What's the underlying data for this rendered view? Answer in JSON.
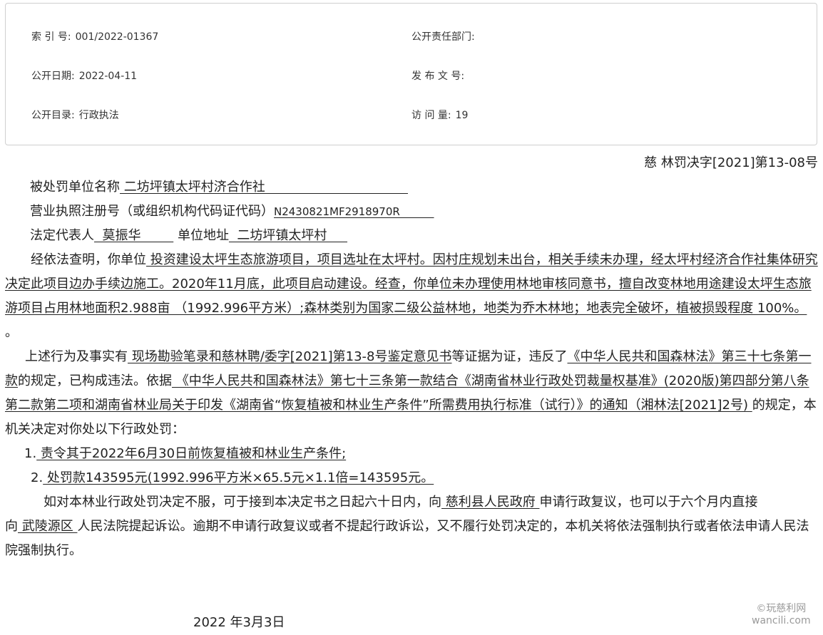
{
  "meta": {
    "index_label": "索 引 号:",
    "index_value": "001/2022-01367",
    "dept_label": "公开责任部门:",
    "dept_value": "",
    "date_label": "公开日期:",
    "date_value": "2022-04-11",
    "docno_label": "发 布 文 号:",
    "docno_value": "",
    "catalog_label": "公开目录:",
    "catalog_value": "行政执法",
    "visits_label": "访 问 量:",
    "visits_value": "19"
  },
  "doc": {
    "number": "慈 林罚决字[2021]第13-08号",
    "unit_label": "被处罚单位名称",
    "unit_value": " 二坊坪镇太坪村济合作社                                   ",
    "license_label": "营业执照注册号（或组织机构代码证代码）",
    "license_value": "N2430821MF2918970R          ",
    "rep_label": "法定代表人",
    "rep_value": "  莫振华        ",
    "addr_label": "单位地址",
    "addr_value": "  二坊坪镇太坪村     ",
    "p1_lead": "经依法查明，你单位",
    "p1_body": " 投资建设太坪生态旅游项目，项目选址在太坪村。因村庄规划未出台，相关手续未办理，经太坪村经济合作社集体研究决定此项目边办手续边施工。2020年11月底，此项目启动建设。经查，你单位未办理使用林地审核同意书，擅自改变林地用途建设太坪生态旅游项目占用林地面积2.988亩 （1992.996平方米）;森林类别为国家二级公益林地，地类为乔木林地；地表完全破坏，植被损毁程度 100%。 ",
    "p1_end": "。",
    "p2_a": "上述行为及事实有",
    "p2_b": " 现场勘验笔录和慈林聘/委字[2021]第13-8号鉴定意见书",
    "p2_c": "等证据为证，违反了",
    "p2_d": "《中华人民共和国森林法》第三十七条第一款",
    "p2_e": "的规定，已构成违法。依据",
    "p2_f": " 《中华人民共和国森林法》第七十三条第一款结合《湖南省林业行政处罚裁量权基准》(2020版)第四部分第八条第二款第二项和湖南省林业局关于印发《湖南省“恢复植被和林业生产条件”所需费用执行标准（试行）》的通知（湘林法[2021]2号) ",
    "p2_g": "的规定，本机关决定对你处以下行政处罚：",
    "item1_num": "1.",
    "item1_text": " 责令其于2022年6月30日前恢复植被和林业生产条件; ",
    "item2_num": "2.",
    "item2_text": " 处罚款143595元(1992.996平方米×65.5元×1.1倍=143595元。 ",
    "p3_a": "如对本林业行政处罚决定不服，可于接到本决定书之日起六十日内，向",
    "p3_b": " 慈利县人民政府 ",
    "p3_c": "申请行政复议，也可以于六个月内直接",
    "p4_a": "向",
    "p4_b": " 武陵源区 ",
    "p4_c": "人民法院提起诉讼。逾期不申请行政复议或者不提起行政诉讼，又不履行处罚决定的，本机关将依法强制执行或者依法申请人民法院强制执行。",
    "date": "2022 年3月3日"
  },
  "watermark": {
    "line1": "©玩慈利网",
    "line2": "wancili.com"
  }
}
